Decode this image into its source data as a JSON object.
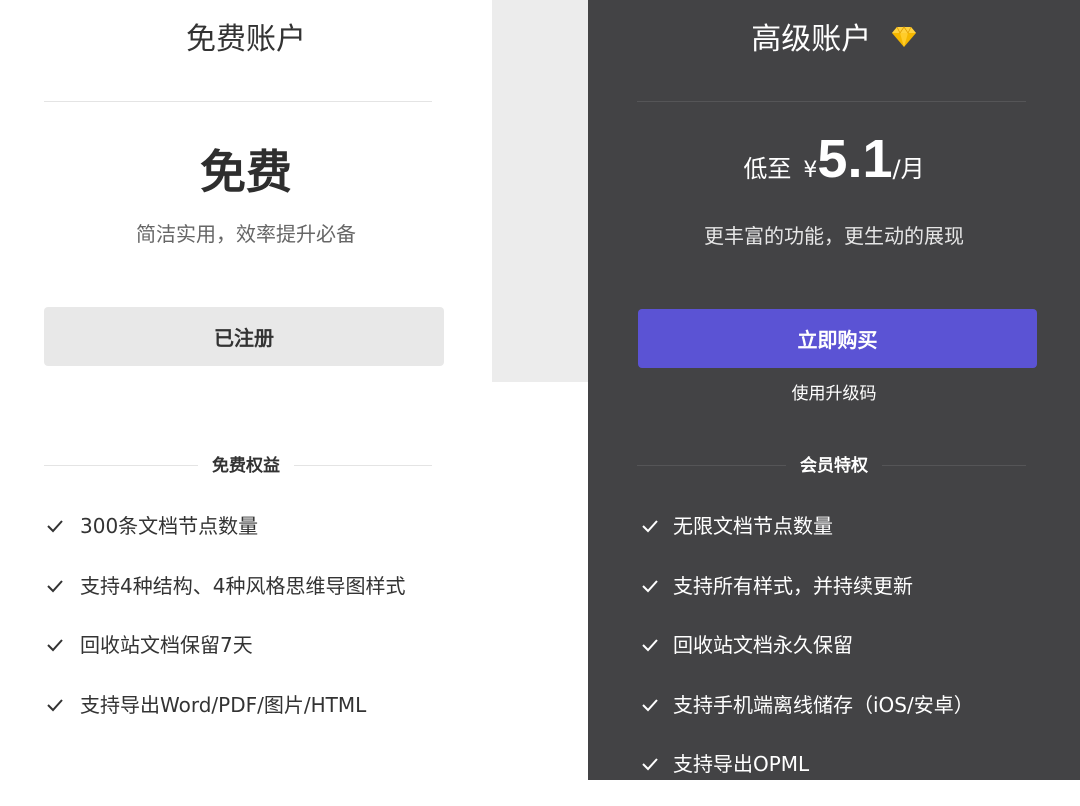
{
  "free": {
    "title": "免费账户",
    "price": "免费",
    "subtitle": "简洁实用，效率提升必备",
    "button_label": "已注册",
    "section_label": "免费权益",
    "features": [
      "300条文档节点数量",
      "支持4种结构、4种风格思维导图样式",
      "回收站文档保留7天",
      "支持导出Word/PDF/图片/HTML"
    ]
  },
  "premium": {
    "title": "高级账户",
    "title_icon": "diamond-icon",
    "price_prefix": "低至",
    "currency": "¥",
    "price_value": "5.1",
    "price_unit": "/月",
    "subtitle": "更丰富的功能，更生动的展现",
    "button_label": "立即购买",
    "upgrade_link": "使用升级码",
    "section_label": "会员特权",
    "features": [
      "无限文档节点数量",
      "支持所有样式，并持续更新",
      "回收站文档永久保留",
      "支持手机端离线储存（iOS/安卓）",
      "支持导出OPML"
    ]
  },
  "colors": {
    "accent_button": "#5b53d4",
    "premium_background": "#434345",
    "free_button": "#e8e8e8",
    "diamond": "#f5b700"
  }
}
